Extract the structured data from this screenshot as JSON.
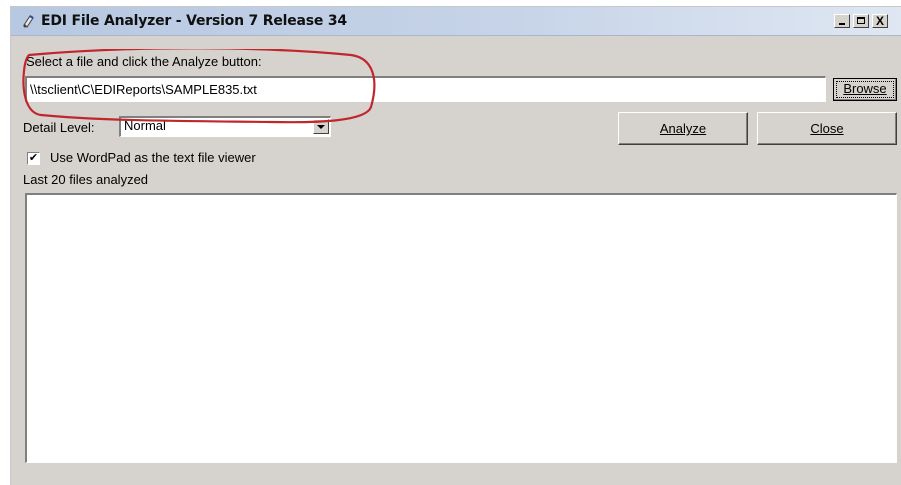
{
  "window": {
    "title": "EDI File Analyzer - Version 7 Release 34",
    "controls": {
      "minimize": "_",
      "maximize": "□",
      "close": "X"
    }
  },
  "file_section": {
    "prompt": "Select a file and click the Analyze button:",
    "path_value": "\\\\tsclient\\C\\EDIReports\\SAMPLE835.txt",
    "browse_label": "Browse"
  },
  "detail": {
    "label": "Detail Level:",
    "selected": "Normal"
  },
  "buttons": {
    "analyze_label": "Analyze",
    "close_label": "Close"
  },
  "options": {
    "wordpad_checked": true,
    "wordpad_label": "Use WordPad as the text file viewer"
  },
  "recent": {
    "label": "Last 20 files analyzed",
    "items": []
  },
  "colors": {
    "annotation": "#c0272d"
  }
}
